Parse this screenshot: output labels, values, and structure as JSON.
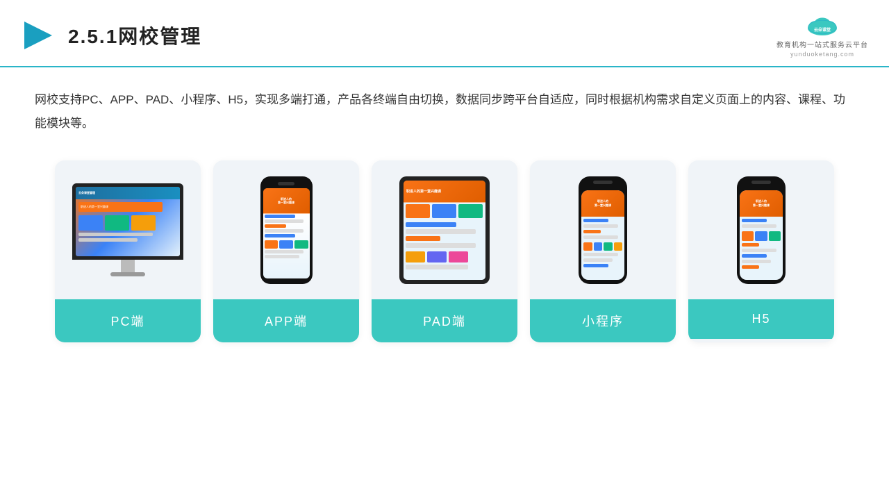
{
  "header": {
    "title": "2.5.1网校管理",
    "logo_name": "云朵课堂",
    "logo_url": "yunduoketang.com",
    "logo_subtitle": "教育机构一站式服务云平台"
  },
  "description": "网校支持PC、APP、PAD、小程序、H5，实现多端打通，产品各终端自由切换，数据同步跨平台自适应，同时根据机构需求自定义页面上的内容、课程、功能模块等。",
  "cards": [
    {
      "id": "pc",
      "label": "PC端"
    },
    {
      "id": "app",
      "label": "APP端"
    },
    {
      "id": "pad",
      "label": "PAD端"
    },
    {
      "id": "miniapp",
      "label": "小程序"
    },
    {
      "id": "h5",
      "label": "H5"
    }
  ]
}
